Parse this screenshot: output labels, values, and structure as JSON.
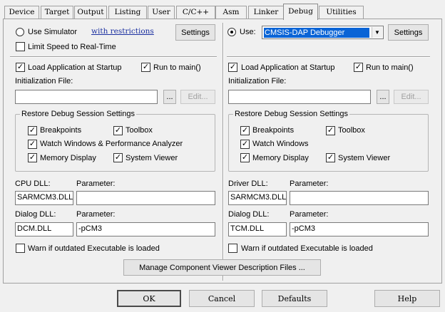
{
  "tabs": [
    {
      "label": "Device"
    },
    {
      "label": "Target"
    },
    {
      "label": "Output"
    },
    {
      "label": "Listing"
    },
    {
      "label": "User"
    },
    {
      "label": "C/C++"
    },
    {
      "label": "Asm"
    },
    {
      "label": "Linker"
    },
    {
      "label": "Debug",
      "active": true
    },
    {
      "label": "Utilities"
    }
  ],
  "left": {
    "use_simulator": {
      "label": "Use Simulator",
      "selected": false
    },
    "restrictions_link": "with restrictions",
    "settings_label": "Settings",
    "limit_speed": {
      "label": "Limit Speed to Real-Time",
      "checked": false
    },
    "load_app": {
      "label": "Load Application at Startup",
      "checked": true
    },
    "run_to_main": {
      "label": "Run to main()",
      "checked": true
    },
    "init_file_label": "Initialization File:",
    "init_file_value": "",
    "browse_label": "...",
    "edit_label": "Edit...",
    "restore_group_title": "Restore Debug Session Settings",
    "breakpoints": {
      "label": "Breakpoints",
      "checked": true
    },
    "toolbox": {
      "label": "Toolbox",
      "checked": true
    },
    "watch_windows": {
      "label": "Watch Windows & Performance Analyzer",
      "checked": true
    },
    "memory_display": {
      "label": "Memory Display",
      "checked": true
    },
    "system_viewer": {
      "label": "System Viewer",
      "checked": true
    },
    "dll_label": "CPU DLL:",
    "dll_param_label": "Parameter:",
    "dll_value": "SARMCM3.DLL",
    "dll_param_value": "",
    "dialog_dll_label": "Dialog DLL:",
    "dialog_param_label": "Parameter:",
    "dialog_dll_value": "DCM.DLL",
    "dialog_param_value": "-pCM3",
    "warn_outdated": {
      "label": "Warn if outdated Executable is loaded",
      "checked": false
    }
  },
  "right": {
    "use": {
      "label": "Use:",
      "selected": true
    },
    "debugger_select": "CMSIS-DAP Debugger",
    "settings_label": "Settings",
    "load_app": {
      "label": "Load Application at Startup",
      "checked": true
    },
    "run_to_main": {
      "label": "Run to main()",
      "checked": true
    },
    "init_file_label": "Initialization File:",
    "init_file_value": "",
    "browse_label": "...",
    "edit_label": "Edit...",
    "restore_group_title": "Restore Debug Session Settings",
    "breakpoints": {
      "label": "Breakpoints",
      "checked": true
    },
    "toolbox": {
      "label": "Toolbox",
      "checked": true
    },
    "watch_windows": {
      "label": "Watch Windows",
      "checked": true
    },
    "memory_display": {
      "label": "Memory Display",
      "checked": true
    },
    "system_viewer": {
      "label": "System Viewer",
      "checked": true
    },
    "dll_label": "Driver DLL:",
    "dll_param_label": "Parameter:",
    "dll_value": "SARMCM3.DLL",
    "dll_param_value": "",
    "dialog_dll_label": "Dialog DLL:",
    "dialog_param_label": "Parameter:",
    "dialog_dll_value": "TCM.DLL",
    "dialog_param_value": "-pCM3",
    "warn_outdated": {
      "label": "Warn if outdated Executable is loaded",
      "checked": false
    }
  },
  "manage_button": "Manage Component Viewer Description Files ...",
  "footer": {
    "ok": "OK",
    "cancel": "Cancel",
    "defaults": "Defaults",
    "help": "Help"
  },
  "colors": {
    "selection": "#0a64d6",
    "link": "#1a2fa0",
    "background": "#f0f0f0"
  },
  "icons": {
    "checkmark": "check-icon",
    "dropdown": "chevron-down-icon"
  }
}
